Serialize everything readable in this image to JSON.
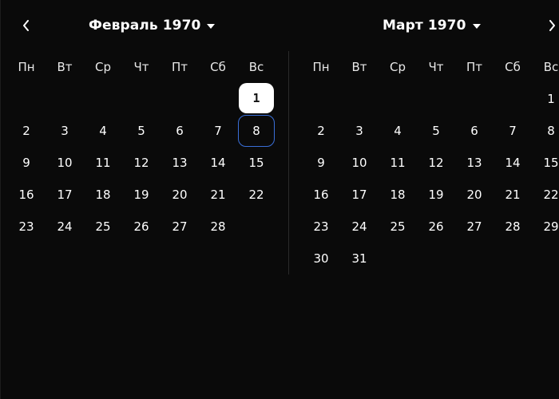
{
  "nav": {
    "prev_icon": "chevron-left-icon",
    "next_icon": "chevron-right-icon"
  },
  "weekdays": [
    "Пн",
    "Вт",
    "Ср",
    "Чт",
    "Пт",
    "Сб",
    "Вс"
  ],
  "months": [
    {
      "title": "Февраль 1970",
      "leading_blanks": 6,
      "days": 28,
      "selected_day": 1,
      "focused_day": 8
    },
    {
      "title": "Март 1970",
      "leading_blanks": 6,
      "days": 31
    }
  ],
  "colors": {
    "background": "#0a0a0a",
    "text": "#ffffff",
    "selected_bg": "#ffffff",
    "focus_ring": "#3a6fd8",
    "divider": "#2a2a2a"
  }
}
